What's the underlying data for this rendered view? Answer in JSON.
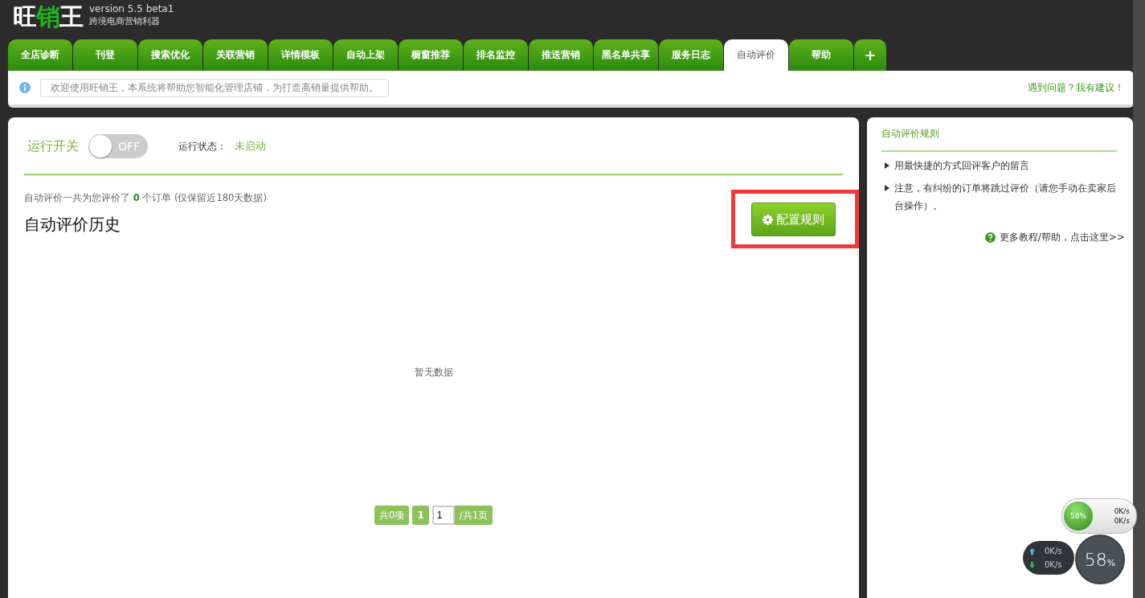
{
  "header": {
    "logo": [
      {
        "text": "旺",
        "highlight": false
      },
      {
        "text": "销",
        "highlight": true
      },
      {
        "text": "王",
        "highlight": false
      }
    ],
    "version": "version 5.5 beta1",
    "slogan": "跨境电商营销利器"
  },
  "tabs": [
    {
      "label": "全店诊断",
      "kind": "text",
      "selected": false
    },
    {
      "label": "刊登",
      "kind": "text",
      "selected": false
    },
    {
      "label": "搜索优化",
      "kind": "text",
      "selected": false
    },
    {
      "label": "关联营销",
      "kind": "text",
      "selected": false
    },
    {
      "label": "详情模板",
      "kind": "text",
      "selected": false
    },
    {
      "label": "自动上架",
      "kind": "text",
      "selected": false
    },
    {
      "label": "橱窗推荐",
      "kind": "text",
      "selected": false
    },
    {
      "label": "排名监控",
      "kind": "text",
      "selected": false
    },
    {
      "label": "推送营销",
      "kind": "text",
      "selected": false
    },
    {
      "label": "黑名单共享",
      "kind": "text",
      "selected": false
    },
    {
      "label": "服务日志",
      "kind": "text",
      "selected": false
    },
    {
      "label": "自动评价",
      "kind": "text",
      "selected": true
    },
    {
      "label": "帮助",
      "kind": "text",
      "selected": false
    },
    {
      "label": "+",
      "kind": "add",
      "selected": false
    }
  ],
  "notice": {
    "message": "欢迎使用旺销王，本系统将帮助您智能化管理店铺，为打造高销量提供帮助。",
    "link": "遇到问题？我有建议！"
  },
  "run": {
    "label": "运行开关",
    "toggle": {
      "on": false,
      "text": "OFF"
    },
    "status_label": "运行状态：",
    "status_value": "未启动"
  },
  "summary": "自动评价一共为您评价了 **0** 个订单 (仅保留近180天数据)",
  "history_title": "自动评价历史",
  "config_button": {
    "label": "配置规则",
    "highlighted": true
  },
  "empty": "暂无数据",
  "pagination": {
    "total": "共0项",
    "pages": [
      {
        "label": "1",
        "selected": true
      }
    ],
    "page_input": "1",
    "page_count": "/共1页"
  },
  "sidebar": {
    "title": "自动评价规则",
    "items": [
      "用最快捷的方式回评客户的留言",
      "注意，有纠纷的订单将跳过评价（请您手动在卖家后台操作）。"
    ],
    "help_link": "更多教程/帮助，点击这里>>"
  },
  "speed_widgets": {
    "small": {
      "percent": "58%",
      "up": "0K/s",
      "down": "0K/s"
    },
    "large": {
      "up": "0K/s",
      "down": "0K/s",
      "percent": "58",
      "unit": "%"
    }
  }
}
